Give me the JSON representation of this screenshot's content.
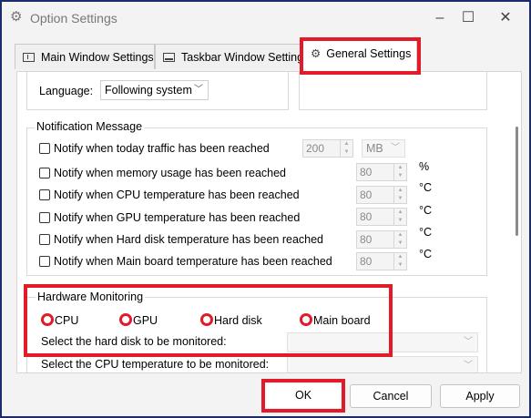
{
  "window": {
    "title": "Option Settings",
    "minimize_glyph": "–",
    "maximize_glyph": "☐",
    "close_glyph": "✕"
  },
  "tabs": [
    {
      "label": "Main Window Settings",
      "icon": "window-icon"
    },
    {
      "label": "Taskbar Window Settings",
      "icon": "taskbar-icon"
    },
    {
      "label": "General Settings",
      "icon": "gear-icon",
      "active": true
    }
  ],
  "general": {
    "language_label": "Language:",
    "language_value": "Following system"
  },
  "notification": {
    "title": "Notification Message",
    "items": [
      {
        "label": "Notify when today traffic has been reached",
        "value": "200",
        "unit": "MB"
      },
      {
        "label": "Notify when memory usage has been reached",
        "value": "80",
        "unit": "%"
      },
      {
        "label": "Notify when CPU temperature has been reached",
        "value": "80",
        "unit": "°C"
      },
      {
        "label": "Notify when GPU temperature has been reached",
        "value": "80",
        "unit": "°C"
      },
      {
        "label": "Notify when Hard disk temperature has been reached",
        "value": "80",
        "unit": "°C"
      },
      {
        "label": "Notify when Main board temperature has been reached",
        "value": "80",
        "unit": "°C"
      }
    ]
  },
  "hardware": {
    "title": "Hardware Monitoring",
    "options": [
      "CPU",
      "GPU",
      "Hard disk",
      "Main board"
    ],
    "hard_disk_label": "Select the hard disk to be monitored:",
    "cpu_temp_label": "Select the CPU temperature to be monitored:"
  },
  "buttons": {
    "ok": "OK",
    "cancel": "Cancel",
    "apply": "Apply"
  },
  "colors": {
    "highlight": "#e21b2a",
    "window_border": "#1b2b6b"
  }
}
